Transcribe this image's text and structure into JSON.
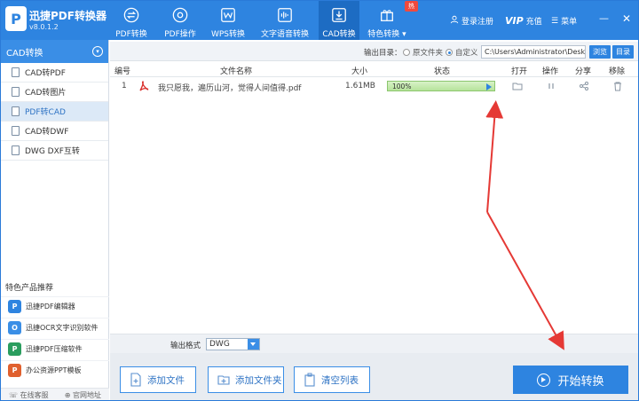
{
  "app": {
    "name": "迅捷PDF转换器",
    "version": "v8.0.1.2",
    "logo_letter": "P"
  },
  "nav": {
    "tabs": [
      {
        "label": "PDF转换",
        "icon": "swap-icon"
      },
      {
        "label": "PDF操作",
        "icon": "gear-icon"
      },
      {
        "label": "WPS转换",
        "icon": "wps-icon"
      },
      {
        "label": "文字语音转换",
        "icon": "audio-wave-icon"
      },
      {
        "label": "CAD转换",
        "icon": "download-box-icon"
      },
      {
        "label": "特色转换",
        "icon": "gift-icon"
      }
    ],
    "hot_badge": "热",
    "login": "登录注册",
    "vip": "VIP",
    "recharge": "充值",
    "menu": "菜单"
  },
  "sidebar": {
    "title": "CAD转换",
    "items": [
      "CAD转PDF",
      "CAD转图片",
      "PDF转CAD",
      "CAD转DWF",
      "DWG DXF互转"
    ],
    "promo_title": "特色产品推荐",
    "promos": [
      {
        "label": "迅捷PDF编辑器",
        "color": "#2e84e0",
        "glyph": "P"
      },
      {
        "label": "迅捷OCR文字识别软件",
        "color": "#3a8ee6",
        "glyph": "O"
      },
      {
        "label": "迅捷PDF压缩软件",
        "color": "#2a9d5e",
        "glyph": "P"
      },
      {
        "label": "办公资源PPT模板",
        "color": "#e0602e",
        "glyph": "P"
      }
    ],
    "footer_service": "在线客服",
    "footer_site": "官网地址"
  },
  "output": {
    "label": "输出目录：",
    "option_original": "原文件夹",
    "option_custom": "自定义",
    "path": "C:\\Users\\Administrator\\Desktop",
    "browse": "浏览",
    "open_dir": "目录"
  },
  "table": {
    "headers": [
      "编号",
      "文件名称",
      "大小",
      "状态",
      "打开",
      "操作",
      "分享",
      "移除"
    ],
    "rows": [
      {
        "index": "1",
        "name": "我只愿我，遍历山河，觉得人间值得.pdf",
        "size": "1.61MB",
        "progress_text": "100%",
        "progress": 1.0
      }
    ]
  },
  "format": {
    "label": "输出格式",
    "value": "DWG"
  },
  "actions": {
    "add_file": "添加文件",
    "add_folder": "添加文件夹",
    "clear": "清空列表",
    "start": "开始转换"
  },
  "colors": {
    "accent": "#2e84e0",
    "annotation": "#e53935",
    "progress": "#b6e39b"
  }
}
